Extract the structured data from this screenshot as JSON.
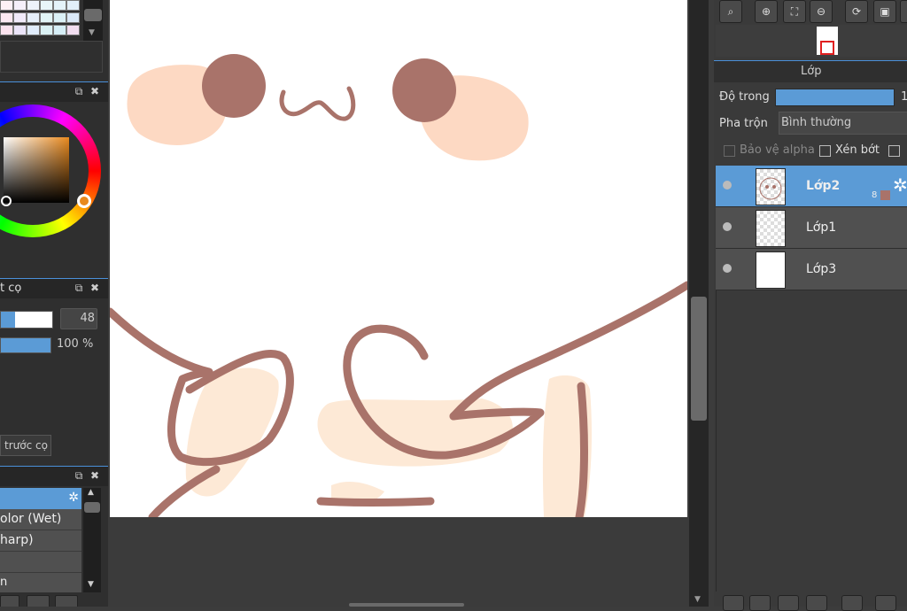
{
  "left_panel": {
    "brush_panel_title": "t cọ",
    "brush_size_value": "48",
    "opacity_value": "100 %",
    "brush_preview_button": "trước cọ",
    "brush_list": [
      "",
      "olor (Wet)",
      "harp)",
      "",
      "n"
    ]
  },
  "right_panel": {
    "layer_panel_title": "Lớp",
    "opacity_label": "Độ trong",
    "opacity_value": "1",
    "blend_label": "Pha trộn",
    "blend_value": "Bình thường",
    "protect_alpha_label": "Bảo vệ alpha",
    "clipping_label": "Xén bớt",
    "layers": [
      {
        "name": "Lớp2",
        "selected": true,
        "badge": "8"
      },
      {
        "name": "Lớp1",
        "selected": false
      },
      {
        "name": "Lớp3",
        "selected": false
      }
    ]
  },
  "colors": {
    "accent": "#5b9bd6",
    "stroke": "#a9736a",
    "blush": "#fdd9c3",
    "panel_bg": "#3a3a3a"
  },
  "icons": [
    "zoom-fit-icon",
    "zoom-in-icon",
    "fit-screen-icon",
    "zoom-out-icon",
    "rotate-icon",
    "fullscreen-icon",
    "gear-icon",
    "close-icon",
    "popout-icon",
    "eye-icon"
  ]
}
